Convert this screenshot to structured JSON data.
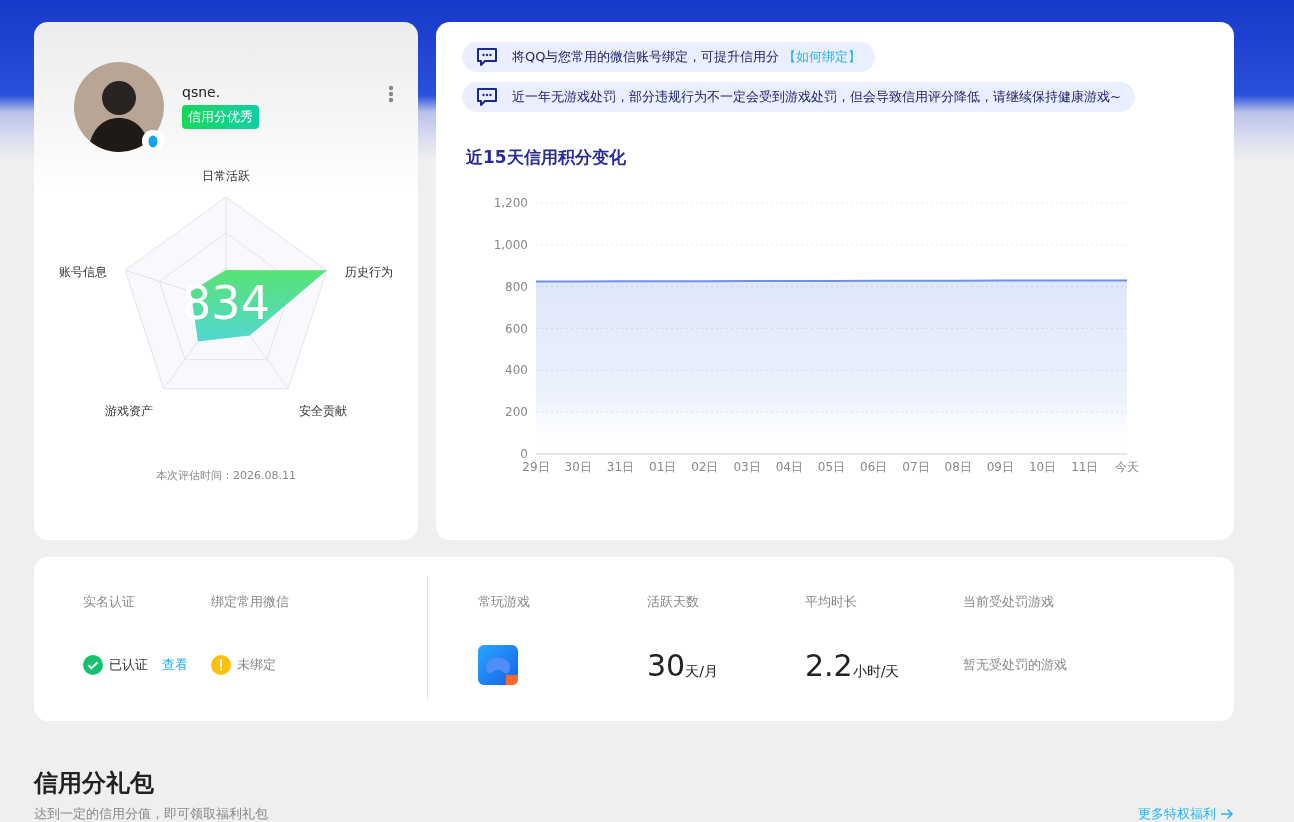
{
  "profile": {
    "name": "qsne.",
    "badge": "信用分优秀",
    "score": "834",
    "radar_labels": [
      "日常活跃",
      "历史行为",
      "安全贡献",
      "游戏资产",
      "账号信息"
    ],
    "evaluated_at": "本次评估时间：2026.08.11"
  },
  "notices": [
    {
      "text": "将QQ与您常用的微信账号绑定，可提升信用分",
      "link": "【如何绑定】"
    },
    {
      "text": "近一年无游戏处罚，部分违规行为不一定会受到游戏处罚，但会导致信用评分降低，请继续保持健康游戏~"
    }
  ],
  "chart_title": "近15天信用积分变化",
  "chart_data": {
    "type": "area",
    "categories": [
      "29日",
      "30日",
      "31日",
      "01日",
      "02日",
      "03日",
      "04日",
      "05日",
      "06日",
      "07日",
      "08日",
      "09日",
      "10日",
      "11日",
      "今天"
    ],
    "grid": true,
    "series": [
      {
        "color": "#6b93ea",
        "values": [
          825,
          825,
          826,
          826,
          826,
          827,
          827,
          827,
          828,
          828,
          828,
          829,
          829,
          829,
          830
        ]
      }
    ],
    "ylim": [
      0,
      1200
    ],
    "yticks": [
      {
        "value": 0,
        "label": "0"
      },
      {
        "value": 200,
        "label": "200"
      },
      {
        "value": 400,
        "label": "400"
      },
      {
        "value": 600,
        "label": "600"
      },
      {
        "value": 800,
        "label": "800"
      },
      {
        "value": 1000,
        "label": "1,000"
      },
      {
        "value": 1200,
        "label": "1,200"
      }
    ]
  },
  "stats": {
    "real_name": {
      "label": "实名认证",
      "status": "已认证",
      "verified": true,
      "link": "查看"
    },
    "wechat": {
      "label": "绑定常用微信",
      "status": "未绑定",
      "verified": false
    },
    "favorite_game": {
      "label": "常玩游戏"
    },
    "active_days": {
      "label": "活跃天数",
      "value": "30",
      "unit": "天/月"
    },
    "avg_time": {
      "label": "平均时长",
      "value": "2.2",
      "unit": "小时/天"
    },
    "penalty": {
      "label": "当前受处罚游戏",
      "value": "暂无受处罚的游戏"
    }
  },
  "gift_section": {
    "title": "信用分礼包",
    "subtitle": "达到一定的信用分值，即可领取福利礼包",
    "more_link": "更多特权福利"
  }
}
